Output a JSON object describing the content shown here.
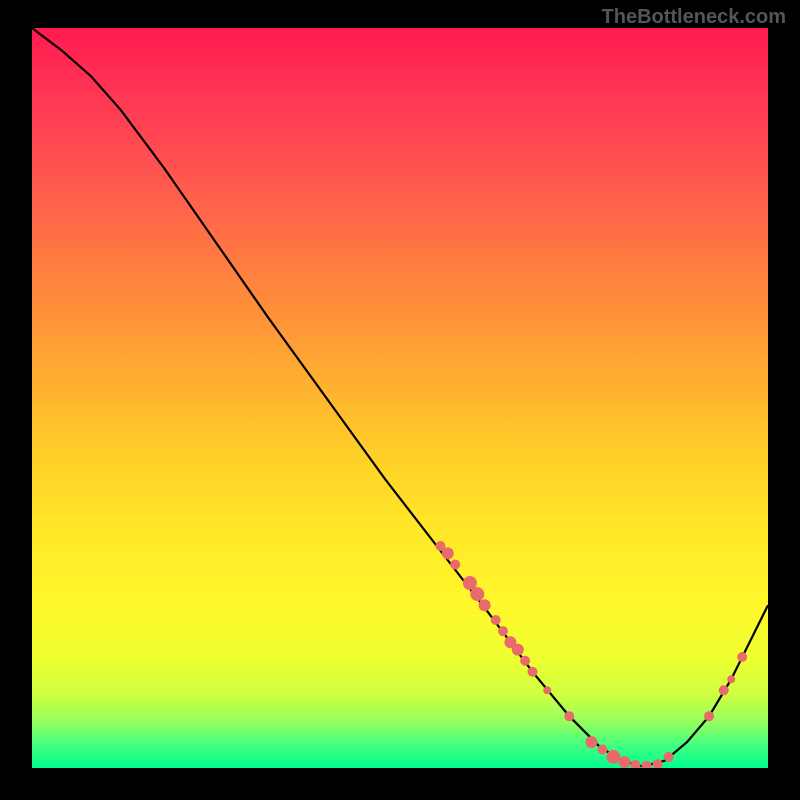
{
  "watermark": "TheBottleneck.com",
  "chart_data": {
    "type": "line",
    "title": "",
    "xlabel": "",
    "ylabel": "",
    "xlim": [
      0,
      100
    ],
    "ylim": [
      0,
      100
    ],
    "series": [
      {
        "name": "curve",
        "x": [
          0,
          4,
          8,
          12,
          18,
          25,
          32,
          40,
          48,
          55,
          62,
          68,
          73,
          77,
          80,
          83,
          86,
          89,
          92,
          95,
          98,
          100
        ],
        "y": [
          100,
          97,
          93.5,
          89,
          81,
          71,
          61,
          50,
          39,
          30,
          21,
          13,
          7,
          3,
          1,
          0.2,
          1,
          3.5,
          7,
          12,
          18,
          22
        ]
      }
    ],
    "points": [
      {
        "x": 55.5,
        "y": 30,
        "r": 5
      },
      {
        "x": 56.5,
        "y": 29,
        "r": 6
      },
      {
        "x": 57.5,
        "y": 27.5,
        "r": 5
      },
      {
        "x": 59.5,
        "y": 25,
        "r": 7
      },
      {
        "x": 60.5,
        "y": 23.5,
        "r": 7
      },
      {
        "x": 61.5,
        "y": 22,
        "r": 6
      },
      {
        "x": 63,
        "y": 20,
        "r": 5
      },
      {
        "x": 64,
        "y": 18.5,
        "r": 5
      },
      {
        "x": 65,
        "y": 17,
        "r": 6
      },
      {
        "x": 66,
        "y": 16,
        "r": 6
      },
      {
        "x": 67,
        "y": 14.5,
        "r": 5
      },
      {
        "x": 68,
        "y": 13,
        "r": 5
      },
      {
        "x": 70,
        "y": 10.5,
        "r": 4
      },
      {
        "x": 73,
        "y": 7,
        "r": 5
      },
      {
        "x": 76,
        "y": 3.5,
        "r": 6
      },
      {
        "x": 77.5,
        "y": 2.5,
        "r": 5
      },
      {
        "x": 79,
        "y": 1.5,
        "r": 7
      },
      {
        "x": 80.5,
        "y": 0.8,
        "r": 6
      },
      {
        "x": 82,
        "y": 0.4,
        "r": 5
      },
      {
        "x": 83.5,
        "y": 0.3,
        "r": 5
      },
      {
        "x": 85,
        "y": 0.5,
        "r": 5
      },
      {
        "x": 86.5,
        "y": 1.5,
        "r": 5
      },
      {
        "x": 92,
        "y": 7,
        "r": 5
      },
      {
        "x": 94,
        "y": 10.5,
        "r": 5
      },
      {
        "x": 95,
        "y": 12,
        "r": 4
      },
      {
        "x": 96.5,
        "y": 15,
        "r": 5
      }
    ],
    "curve_color": "#000000",
    "point_color": "#e96a6a"
  }
}
